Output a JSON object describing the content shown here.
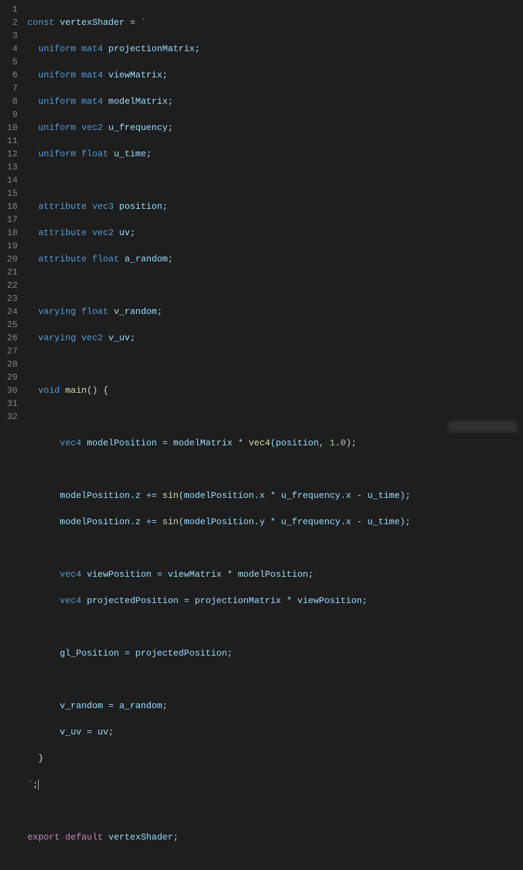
{
  "editor": {
    "language": "javascript-glsl",
    "theme": "dark-plus",
    "cursor": {
      "line": 30,
      "col": 3
    },
    "line_count": 32
  },
  "gutter": {
    "numbers": [
      "1",
      "2",
      "3",
      "4",
      "5",
      "6",
      "7",
      "8",
      "9",
      "10",
      "11",
      "12",
      "13",
      "14",
      "15",
      "16",
      "17",
      "18",
      "19",
      "20",
      "21",
      "22",
      "23",
      "24",
      "25",
      "26",
      "27",
      "28",
      "29",
      "30",
      "31",
      "32"
    ]
  },
  "code": {
    "l1": {
      "a": "const ",
      "b": "vertexShader",
      "c": " = ",
      "d": "`"
    },
    "l2": {
      "a": "  uniform ",
      "b": "mat4",
      "c": " projectionMatrix;"
    },
    "l3": {
      "a": "  uniform ",
      "b": "mat4",
      "c": " viewMatrix;"
    },
    "l4": {
      "a": "  uniform ",
      "b": "mat4",
      "c": " modelMatrix;"
    },
    "l5": {
      "a": "  uniform ",
      "b": "vec2",
      "c": " u_frequency;"
    },
    "l6": {
      "a": "  uniform ",
      "b": "float",
      "c": " u_time;"
    },
    "l7": {
      "a": ""
    },
    "l8": {
      "a": "  attribute ",
      "b": "vec3",
      "c": " position;"
    },
    "l9": {
      "a": "  attribute ",
      "b": "vec2",
      "c": " uv;"
    },
    "l10": {
      "a": "  attribute ",
      "b": "float",
      "c": " a_random;"
    },
    "l11": {
      "a": ""
    },
    "l12": {
      "a": "  varying ",
      "b": "float",
      "c": " v_random;"
    },
    "l13": {
      "a": "  varying ",
      "b": "vec2",
      "c": " v_uv;"
    },
    "l14": {
      "a": ""
    },
    "l15": {
      "a": "  void ",
      "b": "main",
      "c": "() {"
    },
    "l16": {
      "a": ""
    },
    "l17": {
      "a": "      ",
      "b": "vec4",
      "c": " modelPosition = modelMatrix * ",
      "d": "vec4",
      "e": "(position, ",
      "f": "1.0",
      "g": ");"
    },
    "l18": {
      "a": ""
    },
    "l19": {
      "a": "      modelPosition.z += ",
      "b": "sin",
      "c": "(modelPosition.x * u_frequency.x - u_time);"
    },
    "l20": {
      "a": "      modelPosition.z += ",
      "b": "sin",
      "c": "(modelPosition.y * u_frequency.x - u_time);"
    },
    "l21": {
      "a": ""
    },
    "l22": {
      "a": "      ",
      "b": "vec4",
      "c": " viewPosition = viewMatrix * modelPosition;"
    },
    "l23": {
      "a": "      ",
      "b": "vec4",
      "c": " projectedPosition = projectionMatrix * viewPosition;"
    },
    "l24": {
      "a": ""
    },
    "l25": {
      "a": "      gl_Position = projectedPosition;"
    },
    "l26": {
      "a": ""
    },
    "l27": {
      "a": "      v_random = a_random;"
    },
    "l28": {
      "a": "      v_uv = uv;"
    },
    "l29": {
      "a": "  }"
    },
    "l30": {
      "a": "`",
      "b": ";"
    },
    "l31": {
      "a": ""
    },
    "l32": {
      "a": "export ",
      "b": "default ",
      "c": "vertexShader",
      "d": ";"
    }
  }
}
